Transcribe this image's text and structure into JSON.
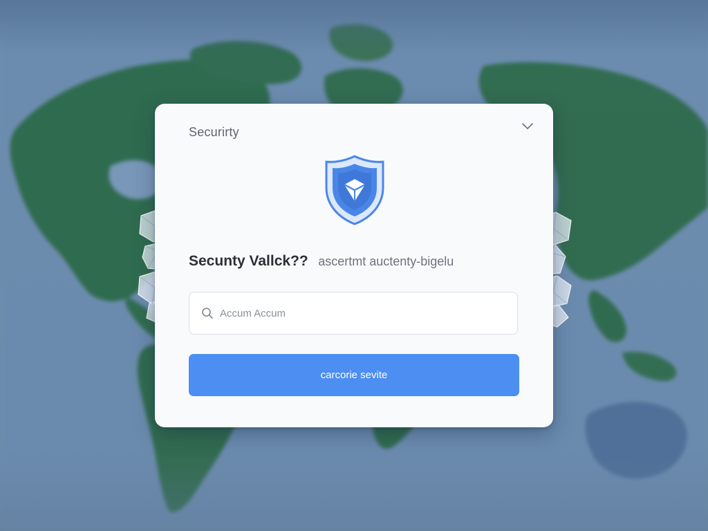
{
  "dialog": {
    "title": "Securirty",
    "headline": "Secunty Vallck??",
    "subheadline": "ascertmt auctenty-bigelu",
    "search": {
      "placeholder": "Accum Accum",
      "value": ""
    },
    "primary_button_label": "carcorie sevite"
  },
  "icons": {
    "close": "chevron-down-icon",
    "shield": "shield-check-icon",
    "search": "search-icon"
  },
  "colors": {
    "accent": "#4c8ef1",
    "shield_blue": "#4a86e8",
    "dialog_bg": "#f9fafc",
    "map_land": "#2f6b4c",
    "map_ocean": "#6f8fb1"
  }
}
